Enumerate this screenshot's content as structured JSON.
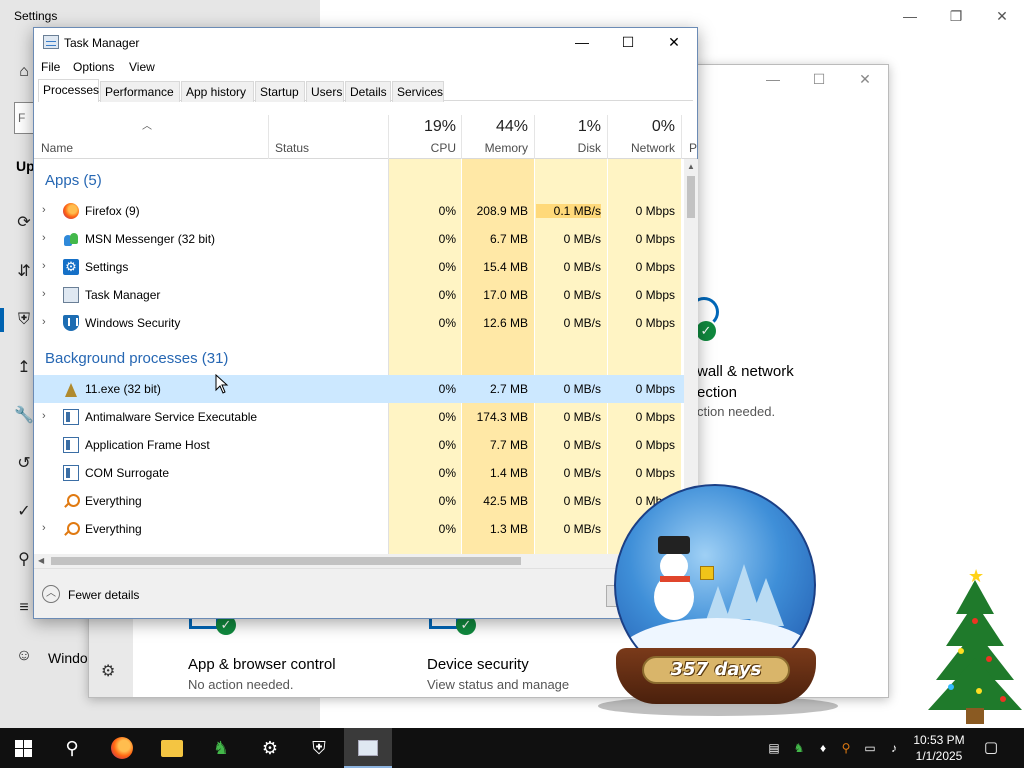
{
  "settings": {
    "title": "Settings",
    "sidebar_fragments": {
      "update": "Up",
      "windows": "Windo"
    },
    "search_placeholder_fragment": "F"
  },
  "windows_security": {
    "firewall_title_line1": "wall & network",
    "firewall_title_line2": "ection",
    "firewall_sub": "ction needed.",
    "app_browser_title": "App & browser control",
    "app_browser_sub": "No action needed.",
    "device_title": "Device security",
    "device_sub": "View status and manage",
    "amp_fragment": "&"
  },
  "task_manager": {
    "title": "Task Manager",
    "menu": [
      "File",
      "Options",
      "View"
    ],
    "tabs": [
      "Processes",
      "Performance",
      "App history",
      "Startup",
      "Users",
      "Details",
      "Services"
    ],
    "active_tab": "Processes",
    "columns": {
      "name": "Name",
      "status": "Status",
      "cpu": {
        "pct": "19%",
        "label": "CPU"
      },
      "memory": {
        "pct": "44%",
        "label": "Memory"
      },
      "disk": {
        "pct": "1%",
        "label": "Disk"
      },
      "network": {
        "pct": "0%",
        "label": "Network"
      },
      "power_fragment": "P"
    },
    "apps_group": "Apps (5)",
    "apps": [
      {
        "name": "Firefox (9)",
        "icon": "firefox-icon",
        "cpu": "0%",
        "memory": "208.9 MB",
        "disk": "0.1 MB/s",
        "network": "0 Mbps"
      },
      {
        "name": "MSN Messenger (32 bit)",
        "icon": "msn-messenger-icon",
        "cpu": "0%",
        "memory": "6.7 MB",
        "disk": "0 MB/s",
        "network": "0 Mbps"
      },
      {
        "name": "Settings",
        "icon": "settings-gear-icon",
        "cpu": "0%",
        "memory": "15.4 MB",
        "disk": "0 MB/s",
        "network": "0 Mbps"
      },
      {
        "name": "Task Manager",
        "icon": "task-manager-icon",
        "cpu": "0%",
        "memory": "17.0 MB",
        "disk": "0 MB/s",
        "network": "0 Mbps"
      },
      {
        "name": "Windows Security",
        "icon": "windows-security-shield-icon",
        "cpu": "0%",
        "memory": "12.6 MB",
        "disk": "0 MB/s",
        "network": "0 Mbps"
      }
    ],
    "background_group": "Background processes (31)",
    "background": [
      {
        "name": "11.exe (32 bit)",
        "icon": "11exe-icon",
        "cpu": "0%",
        "memory": "2.7 MB",
        "disk": "0 MB/s",
        "network": "0 Mbps"
      },
      {
        "name": "Antimalware Service Executable",
        "icon": "window-app-icon",
        "cpu": "0%",
        "memory": "174.3 MB",
        "disk": "0 MB/s",
        "network": "0 Mbps"
      },
      {
        "name": "Application Frame Host",
        "icon": "window-app-icon",
        "cpu": "0%",
        "memory": "7.7 MB",
        "disk": "0 MB/s",
        "network": "0 Mbps"
      },
      {
        "name": "COM Surrogate",
        "icon": "window-app-icon",
        "cpu": "0%",
        "memory": "1.4 MB",
        "disk": "0 MB/s",
        "network": "0 Mbps"
      },
      {
        "name": "Everything",
        "icon": "everything-search-icon",
        "cpu": "0%",
        "memory": "42.5 MB",
        "disk": "0 MB/s",
        "network": "0 Mbps"
      },
      {
        "name": "Everything",
        "icon": "everything-search-icon",
        "cpu": "0%",
        "memory": "1.3 MB",
        "disk": "0 MB/s",
        "network": "0 Mbps"
      }
    ],
    "fewer_details": "Fewer details"
  },
  "snow_globe": {
    "caption": "357 days"
  },
  "taskbar": {
    "pinned": [
      "start-button",
      "search-button",
      "firefox-taskbar-icon",
      "file-explorer-icon",
      "msn-taskbar-icon",
      "settings-taskbar-icon",
      "windows-security-taskbar-icon",
      "task-manager-taskbar-icon"
    ],
    "time": "10:53 PM",
    "date": "1/1/2025"
  },
  "colors": {
    "accent": "#0063b1",
    "group_header": "#2667b3",
    "heat": "#fff4c4",
    "heat_strong": "#ffe8a6",
    "selected_row": "#cce8ff",
    "taskbar": "#101010"
  }
}
